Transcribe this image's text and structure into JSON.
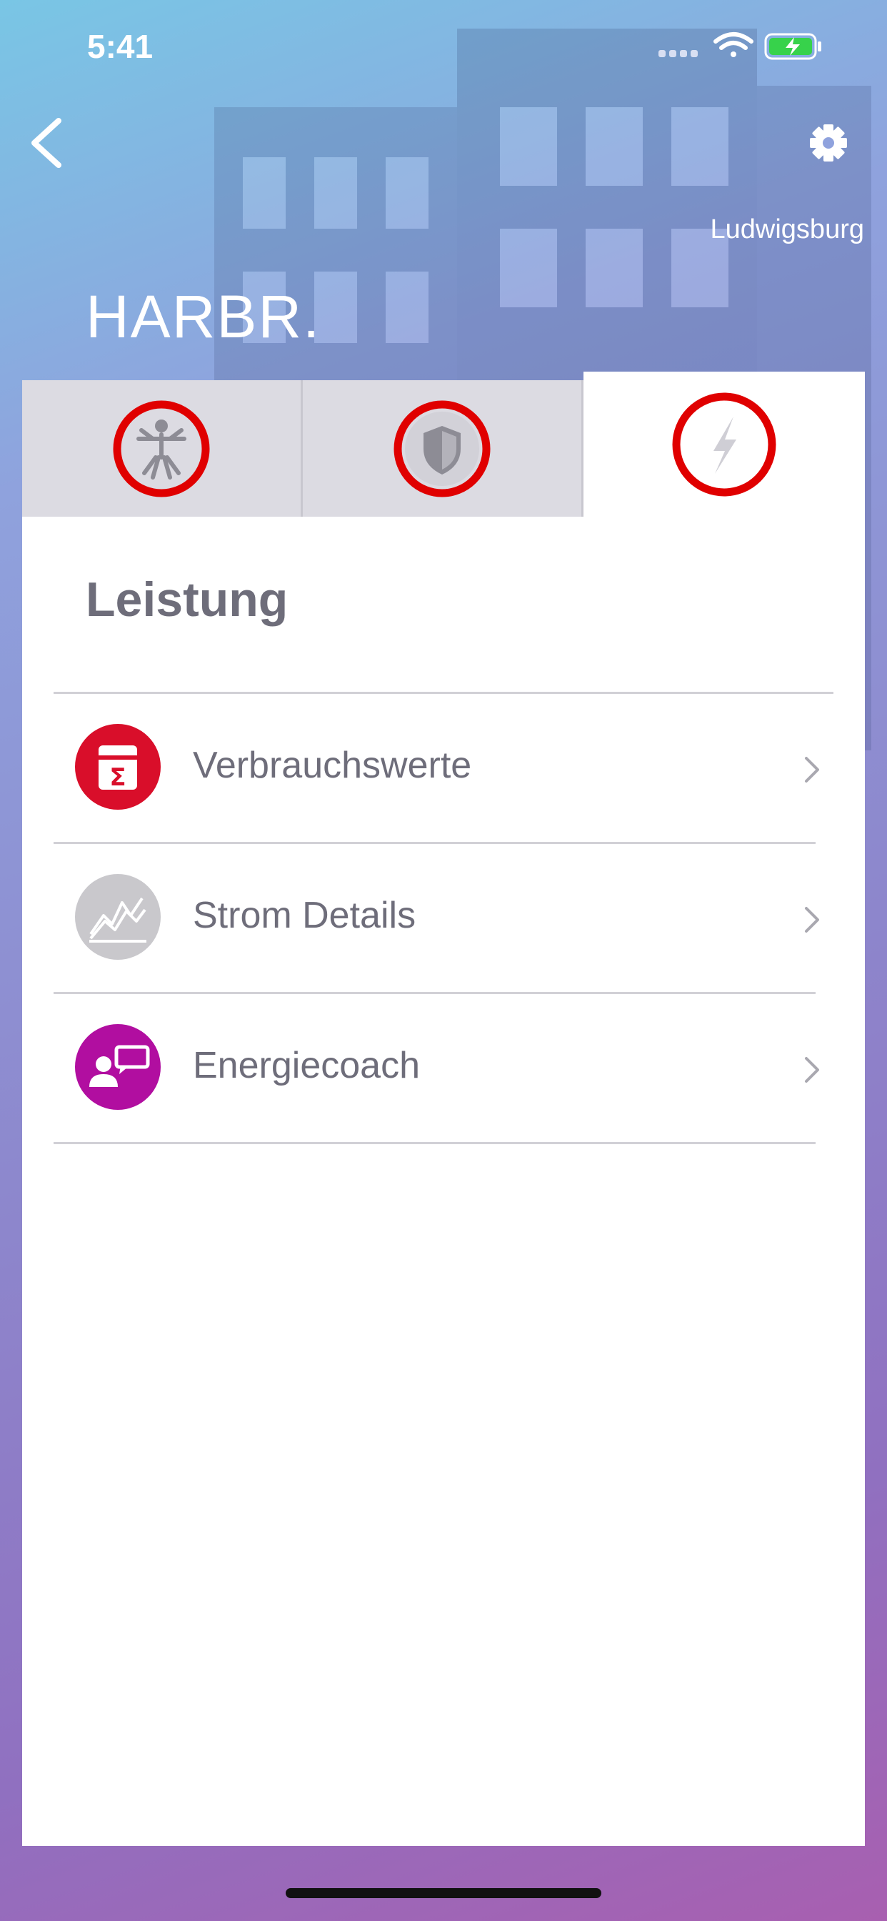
{
  "status_bar": {
    "time": "5:41",
    "icons": [
      "signal-icon",
      "wifi-icon",
      "battery-charging-icon"
    ]
  },
  "header": {
    "back_icon": "chevron-left-icon",
    "settings_icon": "gear-icon",
    "city": "Ludwigsburg",
    "title": "HARBR."
  },
  "tabs": [
    {
      "icon": "vitruvian-person-icon",
      "active": false
    },
    {
      "icon": "shield-icon",
      "active": false
    },
    {
      "icon": "lightning-icon",
      "active": true
    }
  ],
  "section": {
    "heading": "Leistung"
  },
  "menu": [
    {
      "label": "Verbrauchswerte",
      "icon": "consumption-sigma-icon",
      "color": "#d90e2a"
    },
    {
      "label": "Strom Details",
      "icon": "chart-line-icon",
      "color": "#c9c8cc"
    },
    {
      "label": "Energiecoach",
      "icon": "coach-chat-icon",
      "color": "#b10ea0"
    }
  ],
  "colors": {
    "tab_ring": "#e00000",
    "text": "#6e6d7a",
    "tab_inactive_bg": "#dcdbe2"
  }
}
